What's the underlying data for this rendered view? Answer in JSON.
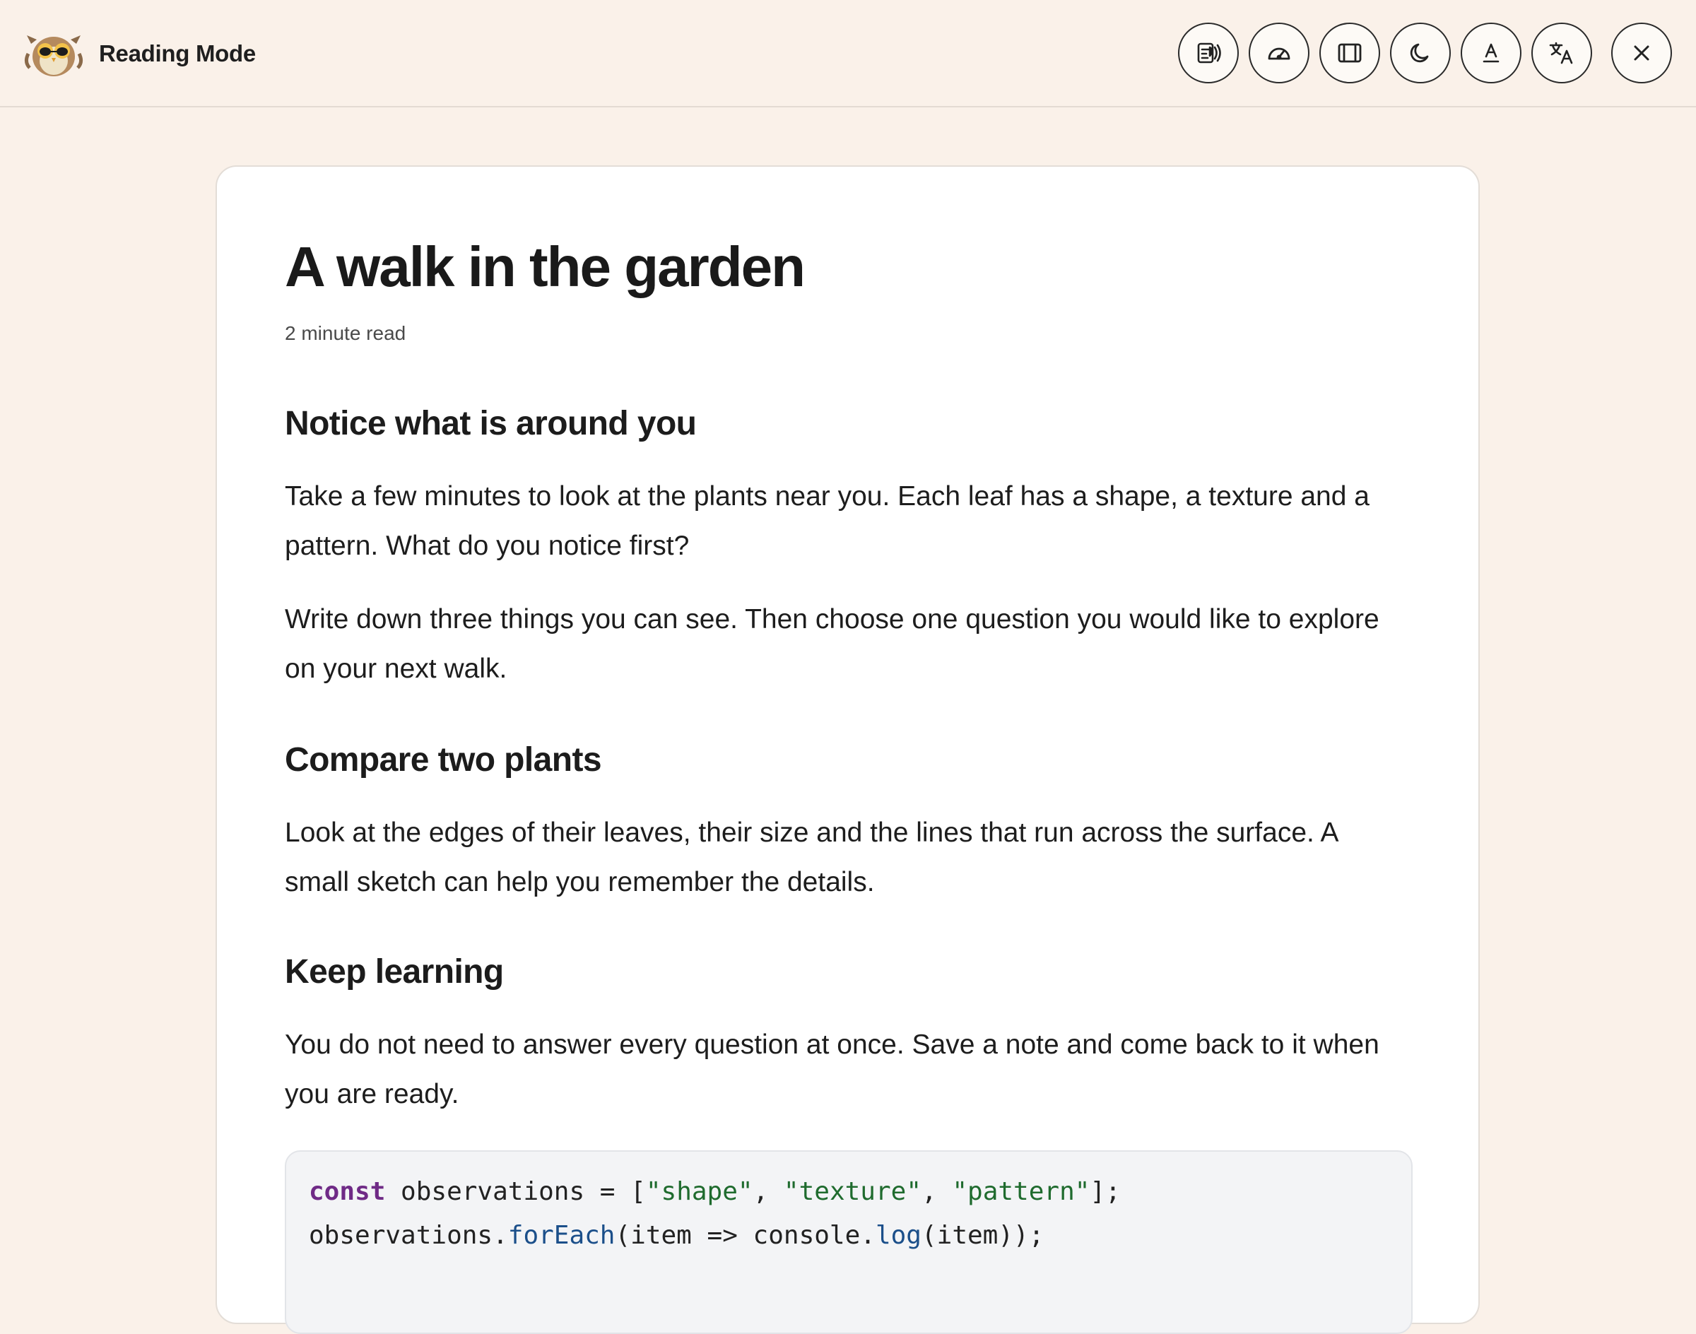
{
  "header": {
    "app_title": "Reading Mode",
    "logo_icon": "owl-logo-icon",
    "tools": [
      {
        "name": "read-aloud",
        "icon": "read-aloud-icon"
      },
      {
        "name": "reading-speed",
        "icon": "speedometer-icon"
      },
      {
        "name": "column-width",
        "icon": "column-width-icon"
      },
      {
        "name": "dark-mode",
        "icon": "moon-icon"
      },
      {
        "name": "text-style",
        "icon": "text-format-icon"
      },
      {
        "name": "translate",
        "icon": "translate-icon"
      },
      {
        "name": "close",
        "icon": "close-icon"
      }
    ]
  },
  "article": {
    "title": "A walk in the garden",
    "read_time": "2 minute read",
    "sections": [
      {
        "heading": "Notice what is around you",
        "paragraphs": [
          "Take a few minutes to look at the plants near you. Each leaf has a shape, a texture and a pattern. What do you notice first?",
          "Write down three things you can see. Then choose one question you would like to explore on your next walk."
        ]
      },
      {
        "heading": "Compare two plants",
        "paragraphs": [
          "Look at the edges of their leaves, their size and the lines that run across the surface. A small sketch can help you remember the details."
        ]
      },
      {
        "heading": "Keep learning",
        "paragraphs": [
          "You do not need to answer every question at once. Save a note and come back to it when you are ready."
        ]
      }
    ],
    "code": {
      "line1": {
        "kw": "const",
        "a": " observations = [",
        "s1": "\"shape\"",
        "c1": ", ",
        "s2": "\"texture\"",
        "c2": ", ",
        "s3": "\"pattern\"",
        "end": "];"
      },
      "line2": {
        "a": "observations.",
        "fn1": "forEach",
        "b": "(item => console.",
        "fn2": "log",
        "c": "(item));"
      }
    }
  },
  "colors": {
    "background": "#faf1e9",
    "card": "#ffffff",
    "code_keyword": "#6f2a86",
    "code_string": "#1f6b2e",
    "code_function": "#1b4f8a"
  }
}
